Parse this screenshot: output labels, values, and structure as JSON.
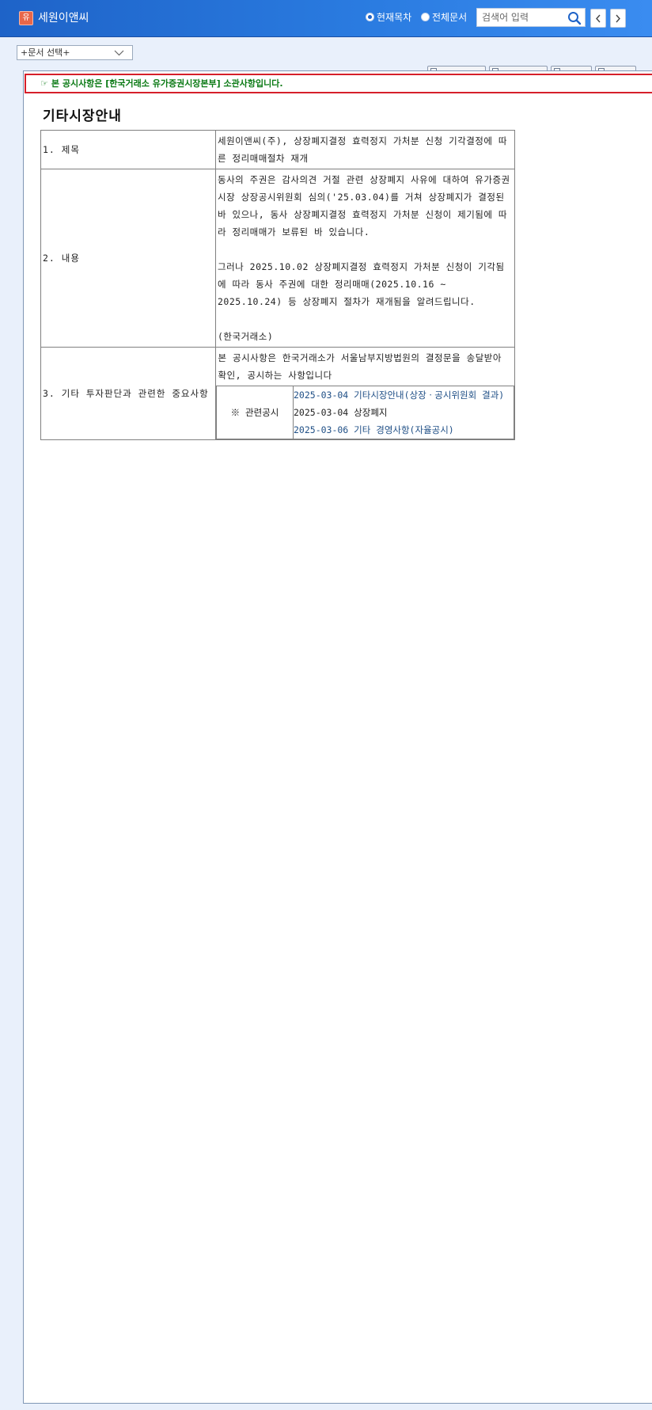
{
  "header": {
    "logo_text": "유",
    "company": "세원이앤씨",
    "radio_current": "현재목차",
    "radio_all": "전체문서",
    "search_placeholder": "검색어 입력",
    "colors": {
      "bar": "#2a7be0",
      "badge": "#e8674a"
    }
  },
  "doc_select": {
    "label": "+문서 선택+"
  },
  "notice": {
    "text": "본 공시사항은 [한국거래소 유가증권시장본부] 소관사항입니다."
  },
  "document": {
    "title": "기타시장안내",
    "rows": {
      "subject_label": "1. 제목",
      "subject_value": "세원이앤씨(주), 상장폐지결정 효력정지 가처분 신청 기각결정에 따른 정리매매절차 재개",
      "content_label": "2. 내용",
      "content_p1": "동사의 주권은 감사의견 거절 관련 상장폐지 사유에 대하여 유가증권시장 상장공시위원회 심의('25.03.04)를 거쳐 상장폐지가 결정된 바 있으나, 동사 상장폐지결정 효력정지 가처분 신청이 제기됨에 따라 정리매매가 보류된 바 있습니다.",
      "content_p2": "그러나 2025.10.02 상장폐지결정 효력정지 가처분 신청이 기각됨에 따라 동사 주권에 대한 정리매매(2025.10.16 ~ 2025.10.24) 등 상장폐지 절차가 재개됨을 알려드립니다.",
      "content_p3": "(한국거래소)",
      "other_label": "3. 기타 투자판단과 관련한 중요사항",
      "other_value": "본 공시사항은 한국거래소가 서울남부지방법원의 결정문을 송달받아 확인, 공시하는 사항입니다",
      "related_label": "※ 관련공시",
      "related": [
        {
          "text": "2025-03-04 기타시장안내(상장ㆍ공시위원회 결과)",
          "link": true
        },
        {
          "text": "2025-03-04 상장폐지",
          "link": false
        },
        {
          "text": "2025-03-06 기타 경영사항(자율공시)",
          "link": true
        }
      ]
    }
  }
}
